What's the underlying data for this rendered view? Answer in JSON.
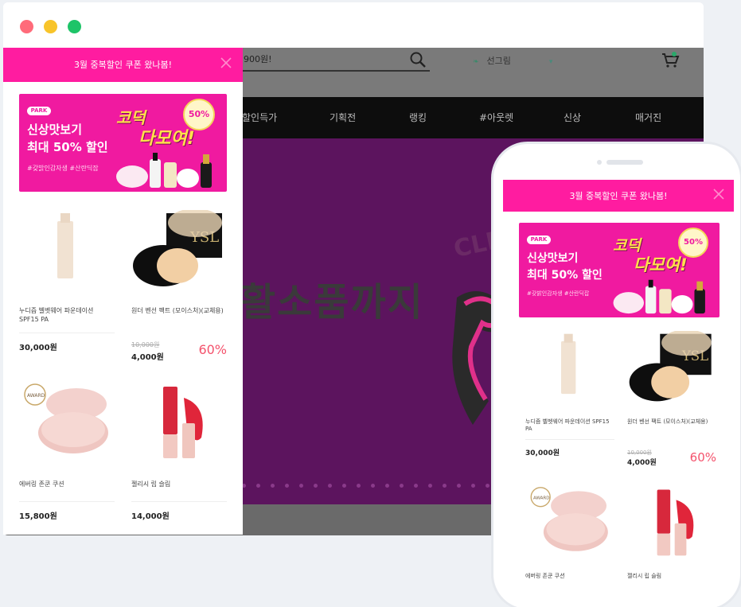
{
  "window_controls": {
    "close": "#ff6b7a",
    "minimize": "#f8c42a",
    "maximize": "#1ec468"
  },
  "site": {
    "search_value": "900원!",
    "login_label": "선그림",
    "nav": [
      "할인득가",
      "기획전",
      "랭킹",
      "#아웃렛",
      "신상",
      "매거진"
    ],
    "banner_text": "활소품까지",
    "banner_word": "CLE"
  },
  "popup": {
    "header": "3월 중복할인 쿠폰 왔나봄!",
    "promo": {
      "tag": "PARK",
      "line1": "신상맛보기",
      "line2": "최대 50% 할인",
      "sub": "#갖밝인감자생 #산란딕잡",
      "title_a": "코덕",
      "title_b": "다모여!",
      "badge": "50%"
    },
    "products": [
      {
        "name": "누디즘 벨벳웨어 파운데이션 SPF15 PA",
        "orig": "",
        "price": "30,000원",
        "rate": ""
      },
      {
        "name": "원더 벤선 팩트 (모이스처)(교체용)",
        "orig": "10,000원",
        "price": "4,000원",
        "rate": "60%"
      },
      {
        "name": "에버링 존쿤 쿠션",
        "orig": "",
        "price": "15,800원",
        "rate": ""
      },
      {
        "name": "젤리시 립 슬림",
        "orig": "",
        "price": "14,000원",
        "rate": ""
      }
    ]
  },
  "phone": {
    "header": "3월 중복할인 쿠폰 왔나봄!",
    "promo": {
      "tag": "PARK",
      "line1": "신상맛보기",
      "line2": "최대 50% 할인",
      "sub": "#갖밝인감자생 #산란딕잡",
      "title_a": "코덕",
      "title_b": "다모여!",
      "badge": "50%"
    },
    "products": [
      {
        "name": "누디즘 벨벳웨어 파운데이션 SPF15 PA",
        "orig": "",
        "price": "30,000원",
        "rate": ""
      },
      {
        "name": "원더 벤선 팩트 (모이스처)(교체용)",
        "orig": "10,000원",
        "price": "4,000원",
        "rate": "60%"
      },
      {
        "name": "에버링 존쿤 쿠션",
        "orig": "",
        "price": "",
        "rate": ""
      },
      {
        "name": "젤리시 립 슬림",
        "orig": "",
        "price": "",
        "rate": ""
      }
    ]
  },
  "colors": {
    "accent": "#ff1ca0",
    "banner": "#5c145e",
    "sale": "#f4526c"
  },
  "icons": [
    "search-icon",
    "cart-icon",
    "close-icon",
    "chevron-down-icon"
  ]
}
